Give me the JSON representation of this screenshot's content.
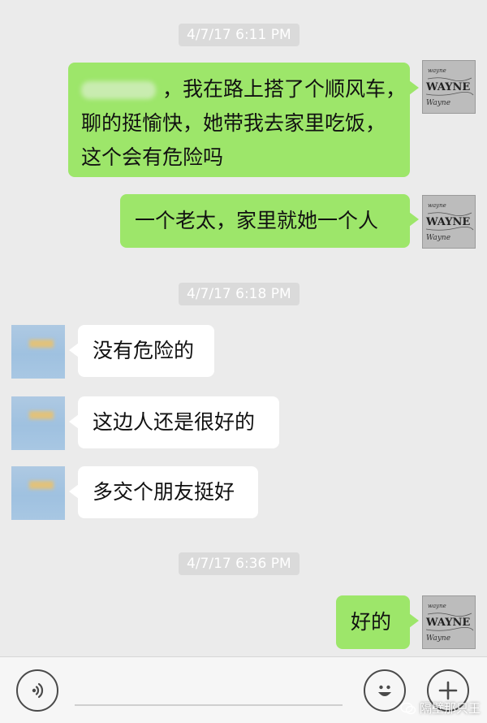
{
  "messages": {
    "timestamps": [
      "4/7/17 6:11 PM",
      "4/7/17 6:18 PM",
      "4/7/17 6:36 PM"
    ],
    "msg1_line1": "，我在路上搭了个顺风车，",
    "msg1_line2": "聊的挺愉快，她带我去家里吃饭，",
    "msg1_line3": "这个会有危险吗",
    "msg2": "一个老太，家里就她一个人",
    "msg3": "没有危险的",
    "msg4": "这边人还是很好的",
    "msg5": "多交个朋友挺好",
    "msg6": "好的"
  },
  "avatar_me": {
    "small_text": "wayne",
    "big_text": "WAYNE",
    "sign": "Wayne"
  },
  "watermark": "隔壁那只王",
  "icons": {
    "voice": "voice-icon",
    "emoji": "emoji-icon",
    "plus": "plus-icon"
  },
  "colors": {
    "my_bubble": "#9de66a",
    "their_bubble": "#ffffff",
    "background": "#ebebeb",
    "timestamp_bg": "#dadada"
  }
}
